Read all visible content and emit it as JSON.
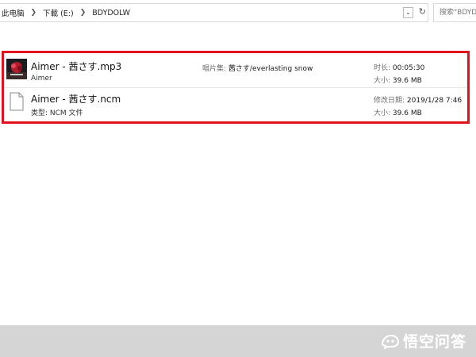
{
  "address": {
    "crumbs": [
      "此电脑",
      "下載 (E:)",
      "BDYDOLW"
    ],
    "dropdown_icon": "chevron-down-icon",
    "refresh_icon": "refresh-icon"
  },
  "search": {
    "placeholder": "搜索\"BDYDOLW\""
  },
  "files": [
    {
      "name": "Aimer - 茜さす.mp3",
      "subtitle": "Aimer",
      "mid_label": "唱片集:",
      "mid_value": "茜さす/everlasting snow",
      "right1_label": "时长:",
      "right1_value": "00:05:30",
      "right2_label": "大小:",
      "right2_value": "39.6 MB",
      "icon": "album-art-thumbnail"
    },
    {
      "name": "Aimer - 茜さす.ncm",
      "subtitle": "类型: NCM 文件",
      "right1_label": "修改日期:",
      "right1_value": "2019/1/28 7:46",
      "right2_label": "大小:",
      "right2_value": "39.6 MB",
      "icon": "blank-file-icon"
    }
  ],
  "watermark": {
    "text": "悟空问答",
    "icon": "wukong-logo-icon"
  },
  "colors": {
    "highlight": "#e3101d",
    "footer": "#d5d5d5"
  }
}
